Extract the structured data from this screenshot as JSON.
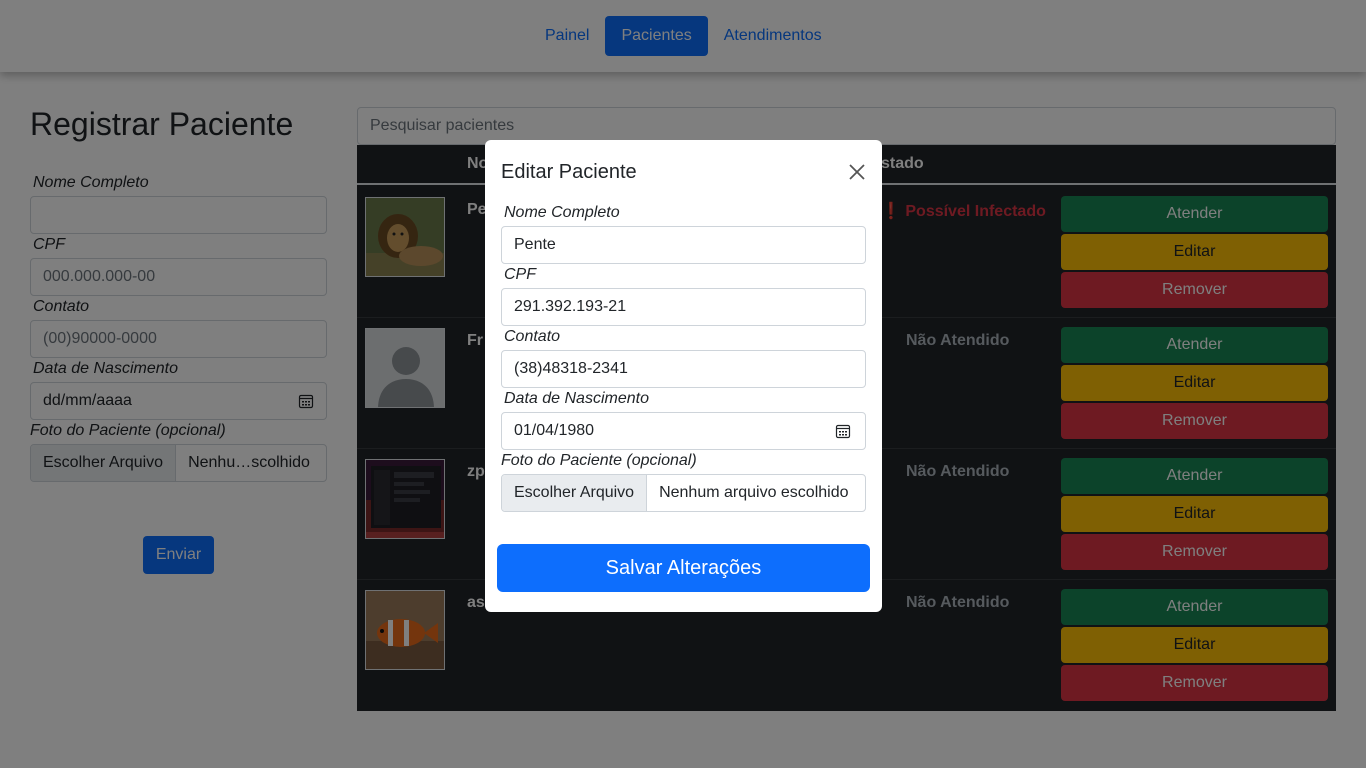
{
  "nav": {
    "items": [
      {
        "label": "Painel",
        "active": false
      },
      {
        "label": "Pacientes",
        "active": true
      },
      {
        "label": "Atendimentos",
        "active": false
      }
    ]
  },
  "register_form": {
    "title": "Registrar Paciente",
    "name_label": "Nome Completo",
    "name_value": "",
    "cpf_label": "CPF",
    "cpf_placeholder": "000.000.000-00",
    "contact_label": "Contato",
    "contact_placeholder": "(00)90000-0000",
    "birth_label": "Data de Nascimento",
    "birth_placeholder": "dd/mm/aaaa",
    "photo_label": "Foto do Paciente (opcional)",
    "file_button": "Escolher Arquivo",
    "file_status": "Nenhu…scolhido",
    "submit": "Enviar"
  },
  "search": {
    "placeholder": "Pesquisar pacientes"
  },
  "table": {
    "headers": [
      "No",
      "stado"
    ],
    "rows": [
      {
        "name": "Pe",
        "state": "❗ Possível Infectado",
        "state_color": "#dc3545",
        "photo": "lion-photo"
      },
      {
        "name": "Fr",
        "state": "Não Atendido",
        "state_color": "#adb5bd",
        "photo": "default-avatar"
      },
      {
        "name": "zp",
        "state": "Não Atendido",
        "state_color": "#adb5bd",
        "photo": "screenshot-photo"
      },
      {
        "name": "as",
        "state": "Não Atendido",
        "state_color": "#adb5bd",
        "photo": "clownfish-photo"
      }
    ],
    "actions": {
      "attend": "Atender",
      "edit": "Editar",
      "remove": "Remover"
    }
  },
  "modal": {
    "title": "Editar Paciente",
    "name_label": "Nome Completo",
    "name_value": "Pente",
    "cpf_label": "CPF",
    "cpf_value": "291.392.193-21",
    "contact_label": "Contato",
    "contact_value": "(38)48318-2341",
    "birth_label": "Data de Nascimento",
    "birth_value": "01/04/1980",
    "photo_label": "Foto do Paciente (opcional)",
    "file_button": "Escolher Arquivo",
    "file_status": "Nenhum arquivo escolhido",
    "save": "Salvar Alterações"
  },
  "colors": {
    "primary": "#0d6efd",
    "success": "#198754",
    "warning": "#ffc107",
    "danger": "#dc3545",
    "table_bg": "#212529"
  }
}
